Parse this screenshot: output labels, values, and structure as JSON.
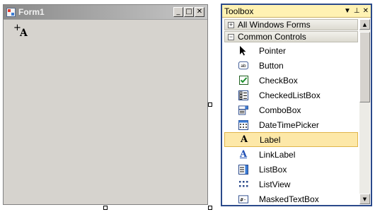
{
  "form": {
    "title": "Form1",
    "controls": {
      "minimize": "_",
      "maximize": "□",
      "close": "✕"
    }
  },
  "toolbox": {
    "title": "Toolbox",
    "header_buttons": {
      "menu": "▼",
      "pin": "⊥",
      "close": "✕"
    },
    "tabs": [
      {
        "label": "All Windows Forms",
        "toggle": "+"
      },
      {
        "label": "Common Controls",
        "toggle": "−"
      }
    ],
    "items": [
      {
        "label": "Pointer",
        "icon": "pointer-icon",
        "selected": false
      },
      {
        "label": "Button",
        "icon": "button-icon",
        "selected": false
      },
      {
        "label": "CheckBox",
        "icon": "checkbox-icon",
        "selected": false
      },
      {
        "label": "CheckedListBox",
        "icon": "checkedlistbox-icon",
        "selected": false
      },
      {
        "label": "ComboBox",
        "icon": "combobox-icon",
        "selected": false
      },
      {
        "label": "DateTimePicker",
        "icon": "datetimepicker-icon",
        "selected": false
      },
      {
        "label": "Label",
        "icon": "label-icon",
        "selected": true
      },
      {
        "label": "LinkLabel",
        "icon": "linklabel-icon",
        "selected": false
      },
      {
        "label": "ListBox",
        "icon": "listbox-icon",
        "selected": false
      },
      {
        "label": "ListView",
        "icon": "listview-icon",
        "selected": false
      },
      {
        "label": "MaskedTextBox",
        "icon": "maskedtextbox-icon",
        "selected": false
      }
    ],
    "scroll": {
      "up": "▲",
      "down": "▼"
    }
  },
  "colors": {
    "form_bg": "#d6d3ce",
    "toolbox_header": "#fff2b3",
    "toolbox_border": "#2b4a8b",
    "selection": "#fde8a8"
  }
}
